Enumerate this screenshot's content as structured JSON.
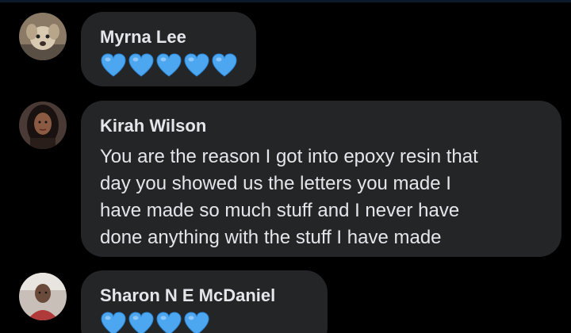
{
  "comments": [
    {
      "author": "Myrna Lee",
      "hearts": 5,
      "heart_icon": "blue-heart-icon"
    },
    {
      "author": "Kirah Wilson",
      "lines": [
        "You are the reason I got into  epoxy resin that",
        "day you showed us the letters you made I",
        "have made so much stuff and I never have",
        "done anything with the stuff I have made"
      ]
    },
    {
      "author": "Sharon N E McDaniel",
      "hearts": 4,
      "heart_icon": "blue-heart-icon"
    }
  ],
  "colors": {
    "background": "#000000",
    "bubble": "#242526",
    "text": "#e4e6eb",
    "heart": "#4da6f0"
  }
}
